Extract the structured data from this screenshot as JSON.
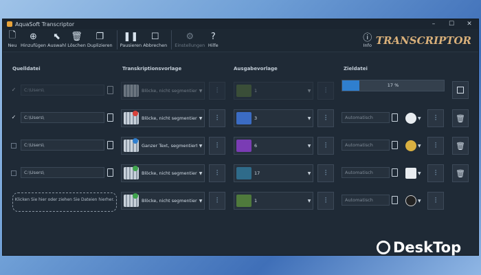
{
  "window": {
    "title": "AquaSoft Transcriptor"
  },
  "toolbar": {
    "neu": "Neu",
    "hinzufuegen": "Hinzufügen",
    "auswahl": "Auswahl",
    "loeschen": "Löschen",
    "duplizieren": "Duplizieren",
    "pausieren": "Pausieren",
    "abbrechen": "Abbrechen",
    "einstellungen": "Einstellungen",
    "hilfe": "Hilfe",
    "info": "Info"
  },
  "logo": "TRANSCRIPTOR",
  "columns": {
    "source": "Quelldatei",
    "template": "Transkriptionsvorlage",
    "output": "Ausgabevorlage",
    "destination": "Zieldatei"
  },
  "rows": [
    {
      "source": "C:\\Users\\",
      "template": "Blöcke, nicht segmentier",
      "output": "1",
      "destination": "",
      "thumb_color": "#5b7a3c"
    },
    {
      "source": "C:\\Users\\",
      "template": "Blöcke, nicht segmentier",
      "output": "3",
      "destination": "Automatisch",
      "thumb_color": "#3b6cc4"
    },
    {
      "source": "C:\\Users\\",
      "template": "Ganzer Text, segmentiert",
      "output": "6",
      "destination": "Automatisch",
      "thumb_color": "#7a3cb4"
    },
    {
      "source": "C:\\Users\\",
      "template": "Blöcke, nicht segmentier",
      "output": "17",
      "destination": "Automatisch",
      "thumb_color": "#2f6b8a"
    },
    {
      "source": "",
      "template": "Blöcke, nicht segmentier",
      "output": "1",
      "destination": "Automatisch",
      "thumb_color": "#4f7a3c"
    }
  ],
  "progress": {
    "value": 17,
    "label": "17 %"
  },
  "dropzone": "Klicken Sie hier oder ziehen Sie Dateien hierher.",
  "watermark": "DeskTop"
}
